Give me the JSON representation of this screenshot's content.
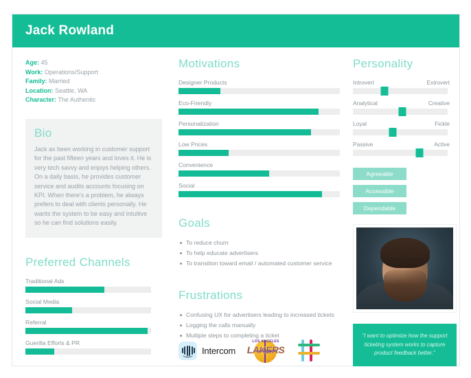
{
  "header": {
    "title": "Jack Rowland"
  },
  "facts": [
    {
      "label": "Age:",
      "value": "45"
    },
    {
      "label": "Work:",
      "value": "Operations/Support"
    },
    {
      "label": "Family:",
      "value": "Married"
    },
    {
      "label": "Location:",
      "value": "Seattle, WA"
    },
    {
      "label": "Character:",
      "value": "The Authentic"
    }
  ],
  "bio": {
    "heading": "Bio",
    "text": "Jack as been working in customer support for the past fifteen years and loves it. He is very tech savvy and enjoys helping others. On a daily basis, he provides customer service and audits accounts focusing on KPI. When there's a problem, he always prefers to deal with clients personally. He wants the system to be easy and intuitive so he can find solutions easily."
  },
  "channels": {
    "heading": "Preferred Channels",
    "items": [
      {
        "label": "Traditional Ads",
        "value": 63
      },
      {
        "label": "Social Media",
        "value": 37
      },
      {
        "label": "Referral",
        "value": 97
      },
      {
        "label": "Guerilla Efforts & PR",
        "value": 23
      }
    ]
  },
  "motivations": {
    "heading": "Motivations",
    "items": [
      {
        "label": "Designer Products",
        "value": 26
      },
      {
        "label": "Eco-Friendly",
        "value": 87
      },
      {
        "label": "Personalization",
        "value": 82
      },
      {
        "label": "Low Prices",
        "value": 31
      },
      {
        "label": "Convenience",
        "value": 56
      },
      {
        "label": "Social",
        "value": 89
      }
    ]
  },
  "goals": {
    "heading": "Goals",
    "items": [
      "To reduce churn",
      "To help educate advertisers",
      "To transition toward email / automated customer service"
    ]
  },
  "frustrations": {
    "heading": "Frustrations",
    "items": [
      "Confusing UX for advertisers leading to increased tickets",
      "Logging the calls manually",
      "Multiple steps to completing a ticket"
    ]
  },
  "personality": {
    "heading": "Personality",
    "items": [
      {
        "left": "Introvert",
        "right": "Extrovert",
        "value": 33
      },
      {
        "left": "Analytical",
        "right": "Creative",
        "value": 52
      },
      {
        "left": "Loyal",
        "right": "Fickle",
        "value": 42
      },
      {
        "left": "Passive",
        "right": "Active",
        "value": 70
      }
    ]
  },
  "traits": [
    "Agreeable",
    "Accessible",
    "Dependable"
  ],
  "quote": {
    "text": "\"I want to optimize how the support ticketing system works to capture product feedback better.\""
  },
  "brands": [
    {
      "name": "intercom",
      "label": "Intercom"
    },
    {
      "name": "lakers",
      "top": "LOS ANGELES",
      "label": "LAKERS"
    },
    {
      "name": "slack",
      "label": "Slack"
    }
  ],
  "colors": {
    "accent": "#14bd96",
    "accent_light": "#8ddcc9",
    "heading": "#7fdcc6",
    "track": "#ededed",
    "text": "#8c9499",
    "bio_bg": "#f1f2f2"
  },
  "chart_data": [
    {
      "type": "bar",
      "title": "Preferred Channels",
      "categories": [
        "Traditional Ads",
        "Social Media",
        "Referral",
        "Guerilla Efforts & PR"
      ],
      "values": [
        63,
        37,
        97,
        23
      ],
      "xlabel": "",
      "ylabel": "",
      "ylim": [
        0,
        100
      ],
      "orientation": "horizontal",
      "grid": false,
      "legend": "none"
    },
    {
      "type": "bar",
      "title": "Motivations",
      "categories": [
        "Designer Products",
        "Eco-Friendly",
        "Personalization",
        "Low Prices",
        "Convenience",
        "Social"
      ],
      "values": [
        26,
        87,
        82,
        31,
        56,
        89
      ],
      "xlabel": "",
      "ylabel": "",
      "ylim": [
        0,
        100
      ],
      "orientation": "horizontal",
      "grid": false,
      "legend": "none"
    },
    {
      "type": "bar",
      "title": "Personality",
      "categories": [
        "Introvert-Extrovert",
        "Analytical-Creative",
        "Loyal-Fickle",
        "Passive-Active"
      ],
      "values": [
        33,
        52,
        42,
        70
      ],
      "xlabel": "",
      "ylabel": "",
      "ylim": [
        0,
        100
      ],
      "orientation": "horizontal",
      "grid": false,
      "legend": "none"
    }
  ]
}
